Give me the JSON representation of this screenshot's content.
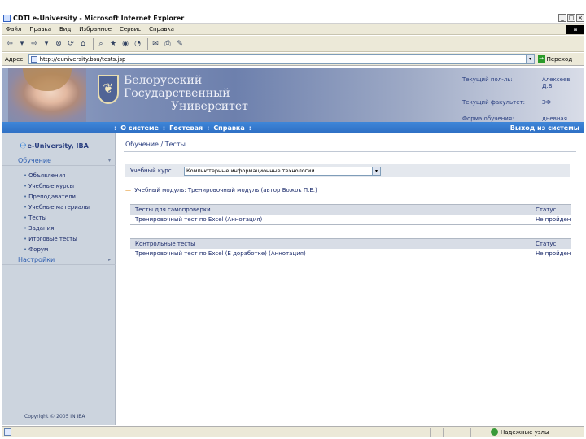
{
  "window": {
    "title": "CDTI e-University - Microsoft Internet Explorer",
    "buttons": {
      "minimize": "_",
      "maximize": "□",
      "close": "×"
    }
  },
  "menu": {
    "items": [
      "Файл",
      "Правка",
      "Вид",
      "Избранное",
      "Сервис",
      "Справка"
    ],
    "logo": "⊞"
  },
  "toolbar": {
    "buttons": [
      {
        "name": "back-icon",
        "glyph": "⇦"
      },
      {
        "name": "dropdown-icon",
        "glyph": "▾"
      },
      {
        "name": "forward-icon",
        "glyph": "⇨"
      },
      {
        "name": "dropdown-icon",
        "glyph": "▾"
      },
      {
        "name": "stop-icon",
        "glyph": "⊗"
      },
      {
        "name": "refresh-icon",
        "glyph": "⟳"
      },
      {
        "name": "home-icon",
        "glyph": "⌂"
      },
      {
        "name": "search-icon",
        "glyph": "⌕"
      },
      {
        "name": "favorites-icon",
        "glyph": "★"
      },
      {
        "name": "media-icon",
        "glyph": "◉"
      },
      {
        "name": "history-icon",
        "glyph": "◔"
      },
      {
        "name": "mail-icon",
        "glyph": "✉"
      },
      {
        "name": "print-icon",
        "glyph": "⎙"
      },
      {
        "name": "edit-icon",
        "glyph": "✎"
      }
    ]
  },
  "address": {
    "label": "Адрес:",
    "url": "http://euniversity.bsu/tests.jsp",
    "go_label": "Переход",
    "go_glyph": "→"
  },
  "header": {
    "university_line1": "Белорусский",
    "university_line2": "Государственный",
    "university_line3": "Университет",
    "crest_glyph": "❦",
    "user_rows": [
      {
        "label": "Текущий пол-ль:",
        "value": "Алексеев Д.В."
      },
      {
        "label": "Текущий факультет:",
        "value": "ЭФ"
      },
      {
        "label": "Форма обучения:",
        "value": "дневная"
      }
    ]
  },
  "nav": {
    "items": [
      "О системе",
      "Гостевая",
      "Справка"
    ],
    "separator": ":",
    "exit": "Выход из системы"
  },
  "sidebar": {
    "brand": "e-University, IBA",
    "brand_icon": "℮",
    "section_study": "Обучение",
    "section_settings": "Настройки",
    "chevron_down": "▾",
    "chevron_right": "▸",
    "bullet": "•",
    "items": [
      "Объявления",
      "Учебные курсы",
      "Преподаватели",
      "Учебные материалы",
      "Тесты",
      "Задания",
      "Итоговые тесты",
      "Форум"
    ],
    "copyright": "Copyright © 2005 IN IBA"
  },
  "main": {
    "breadcrumb": "Обучение / Тесты",
    "course_label": "Учебный курс",
    "course_value": "Компьютерные информационные технологии",
    "dropdown_glyph": "▾",
    "module_dash": "—",
    "module_text": "Учебный модуль: Тренировочный модуль (автор Божок П.Е.)",
    "self_tests": {
      "header": "Тесты для самопроверки",
      "status_header": "Статус",
      "rows": [
        {
          "name": "Тренировочный тест по Excel",
          "link": "(Аннотация)",
          "status": "Не пройден"
        }
      ]
    },
    "control_tests": {
      "header": "Контрольные тесты",
      "status_header": "Статус",
      "rows": [
        {
          "name": "Тренировочный тест по Excel (Е доработке)",
          "link": "(Аннотация)",
          "status": "Не пройден"
        }
      ]
    }
  },
  "status": {
    "text": "",
    "zone": "Надежные узлы"
  }
}
